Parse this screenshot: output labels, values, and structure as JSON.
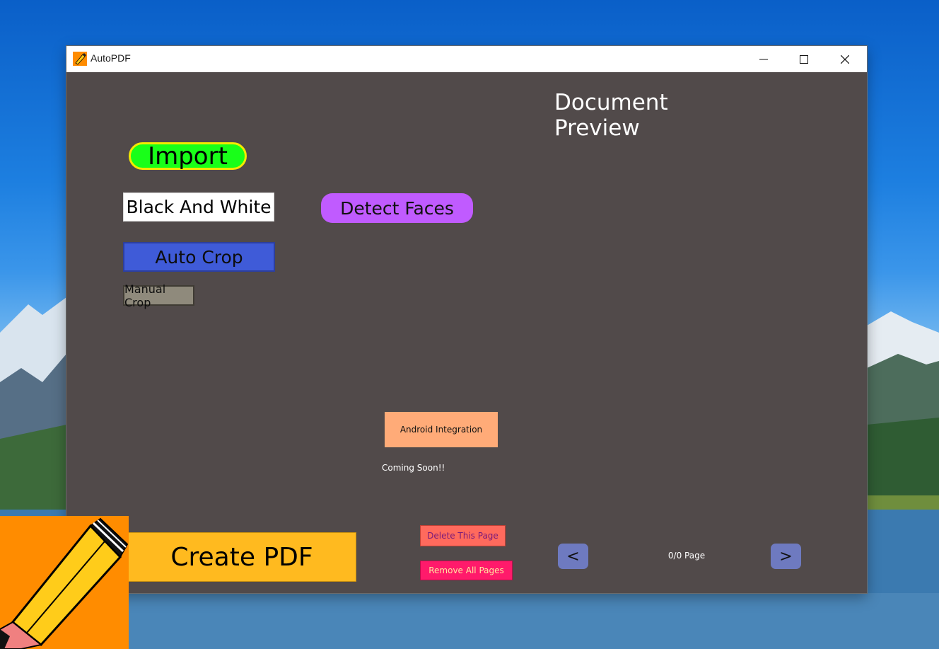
{
  "window": {
    "title": "AutoPDF"
  },
  "left_panel": {
    "import_label": "Import",
    "black_white_label": "Black And White",
    "detect_faces_label": "Detect Faces",
    "auto_crop_label": "Auto Crop",
    "manual_crop_label": "Manual Crop"
  },
  "preview": {
    "title": "Document Preview"
  },
  "android": {
    "button_label": "Android Integration",
    "status_text": "Coming Soon!!"
  },
  "footer": {
    "create_pdf_label": "Create PDF",
    "delete_page_label": "Delete This Page",
    "remove_all_label": "Remove All Pages",
    "prev_label": "<",
    "next_label": ">",
    "page_indicator": "0/0 Page"
  },
  "colors": {
    "window_bg": "#514a4a",
    "import_bg": "#19ff19",
    "import_border": "#f5ea00",
    "detect_faces_bg": "#c05bff",
    "auto_crop_bg": "#3f5bd8",
    "android_bg": "#ffab78",
    "create_pdf_bg": "#ffba1f",
    "delete_bg": "#ff6a5d",
    "remove_bg": "#ff1a6b",
    "nav_bg": "#6e7ac0"
  }
}
